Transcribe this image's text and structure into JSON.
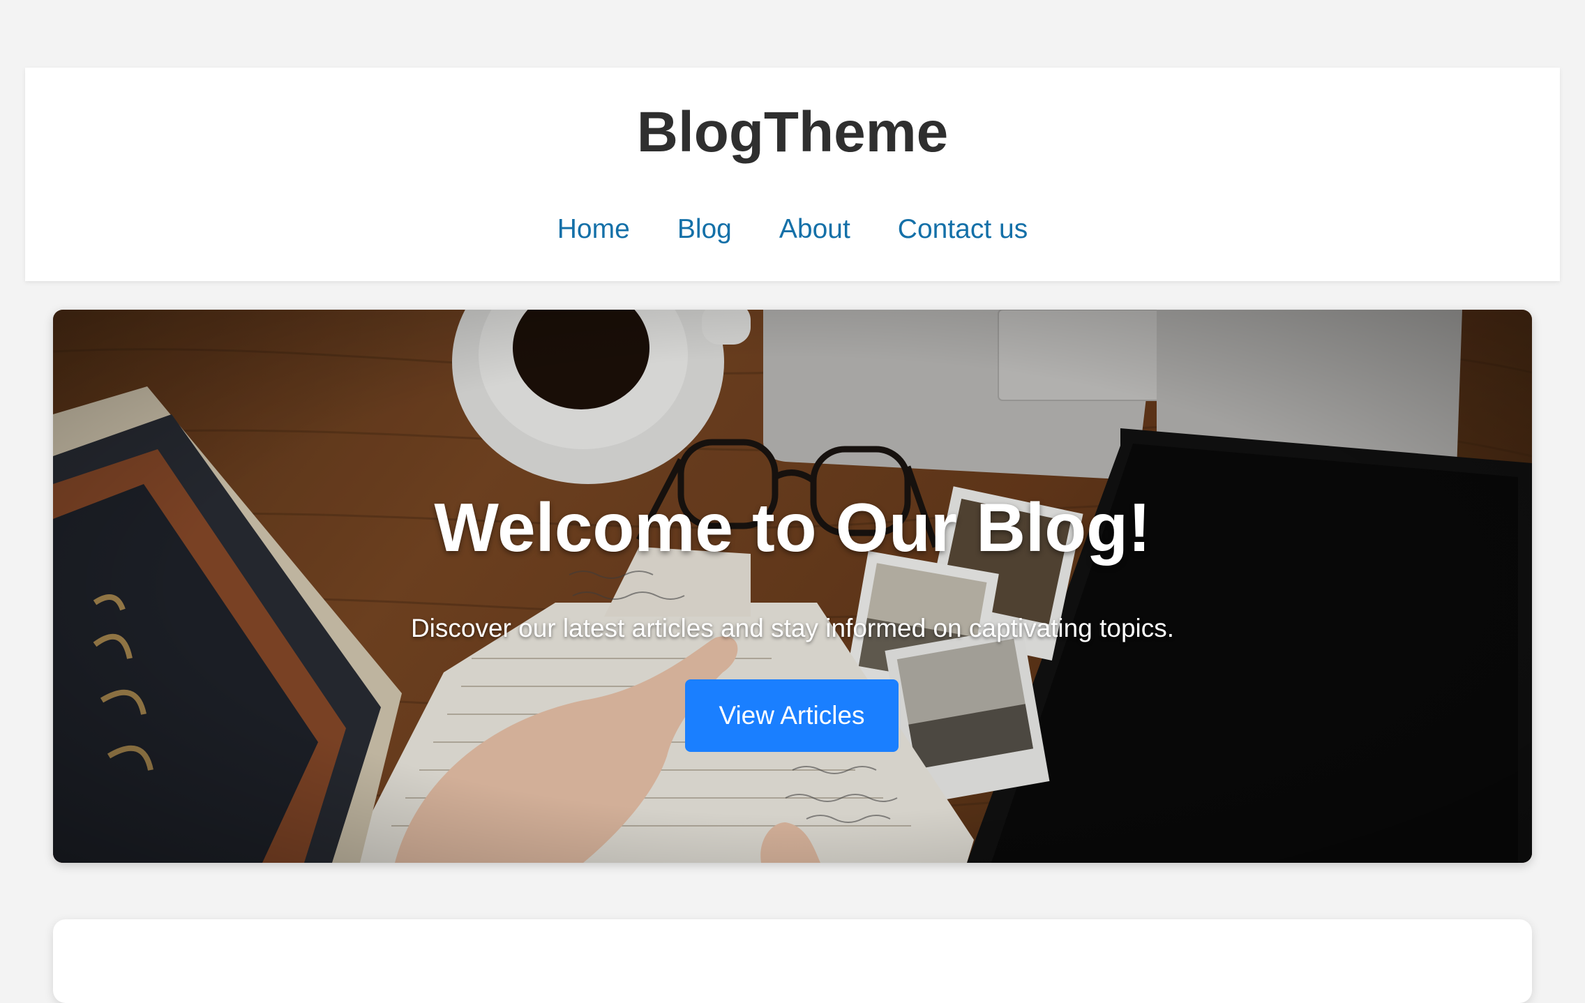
{
  "header": {
    "site_title": "BlogTheme",
    "nav": [
      {
        "label": "Home"
      },
      {
        "label": "Blog"
      },
      {
        "label": "About"
      },
      {
        "label": "Contact us"
      }
    ]
  },
  "hero": {
    "title": "Welcome to Our Blog!",
    "subtitle": "Discover our latest articles and stay informed on captivating topics.",
    "button_label": "View Articles",
    "image_icon": "desk-flatlay-photo"
  },
  "colors": {
    "page_bg": "#f3f3f3",
    "nav_link": "#1470a8",
    "title": "#2f2f2f",
    "button_bg": "#1a7fff"
  }
}
